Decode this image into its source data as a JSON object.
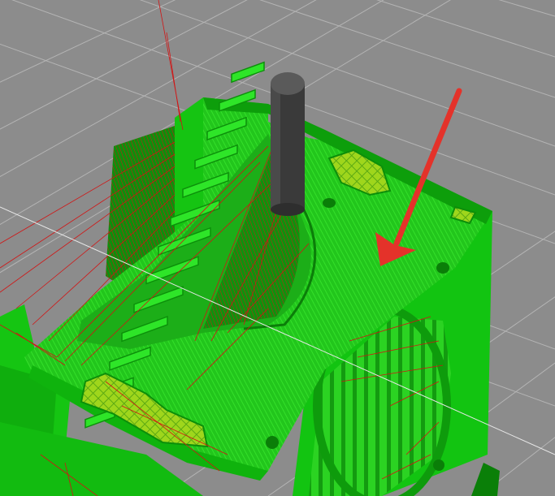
{
  "app": {
    "view": "3d-toolpath-preview"
  },
  "colors": {
    "background": "#8c8c8c",
    "grid_line": "#b4b4b4",
    "perimeter_green": "#11d40f",
    "top_fill_green": "#22c61c",
    "infill_yellow_green": "#9fd61c",
    "travel_red": "#d21414",
    "extruder_nozzle": "#3a3a3a",
    "annotation_arrow": "#e4322a"
  },
  "icons": [
    "annotation-arrow-icon",
    "nozzle-icon"
  ]
}
